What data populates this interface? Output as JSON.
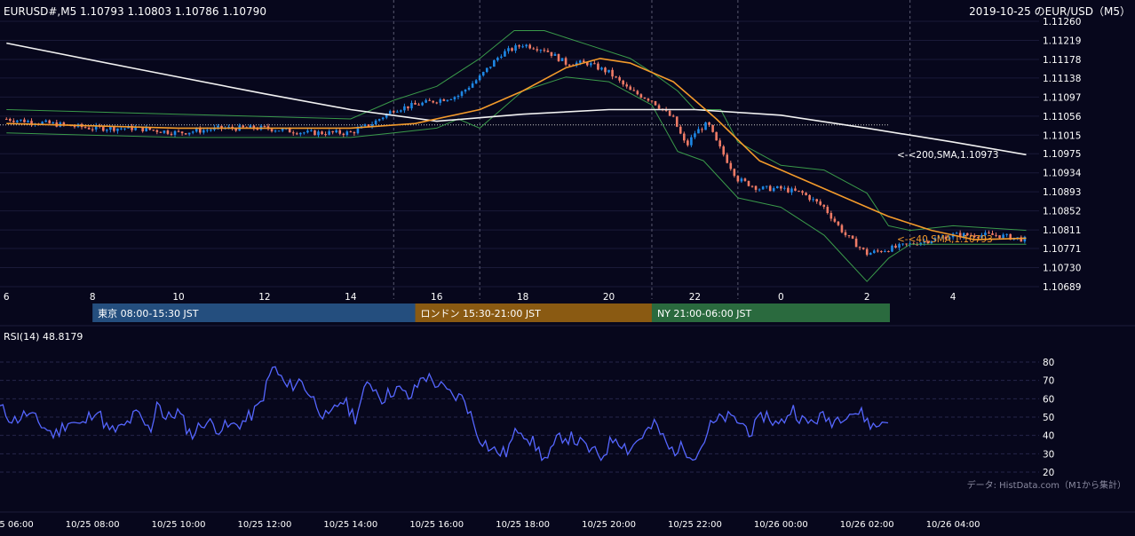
{
  "header": {
    "ohlc_label": "EURUSD#,M5 1.10793 1.10803 1.10786 1.10790",
    "right_title": "2019-10-25 のEUR/USD（M5）"
  },
  "colors": {
    "background": "#07071c",
    "candle_up": "#1e88e5",
    "candle_down": "#ef7b66",
    "sma200": "#f2f2f2",
    "sma40": "#f39a2b",
    "bollinger": "#3a9a4a",
    "rsi": "#5566ff",
    "session_tokyo": "#244e7e",
    "session_london": "#8a5a12",
    "session_ny": "#2a6a3e"
  },
  "sessions": [
    {
      "label": "東京 08:00-15:30 JST",
      "start_hour": 8,
      "end_hour": 15.5
    },
    {
      "label": "ロンドン 15:30-21:00 JST",
      "start_hour": 15.5,
      "end_hour": 21
    },
    {
      "label": "NY 21:00-06:00 JST",
      "start_hour": 21,
      "end_hour": 30
    }
  ],
  "indicator_labels": {
    "sma200": "<-<200,SMA,1.10973",
    "sma40": "<-<40,SMA,1.10793"
  },
  "rsi_label": "RSI(14) 48.8179",
  "source_note": "データ: HistData.com（M1から集計）",
  "chart_data": [
    {
      "type": "candlestick",
      "timeframe": "M5",
      "x_unit": "hours since 2019-10-25 00:00 JST",
      "x_range": [
        6,
        29.7
      ],
      "ylim": [
        1.10689,
        1.1126
      ],
      "y_ticks": [
        "1.11260",
        "1.11219",
        "1.11178",
        "1.11138",
        "1.11097",
        "1.11056",
        "1.11015",
        "1.10975",
        "1.10934",
        "1.10893",
        "1.10852",
        "1.10811",
        "1.10771",
        "1.10730",
        "1.10689"
      ],
      "x_ticks": [
        {
          "x": 6,
          "label": "6"
        },
        {
          "x": 8,
          "label": "8"
        },
        {
          "x": 10,
          "label": "10"
        },
        {
          "x": 12,
          "label": "12"
        },
        {
          "x": 14,
          "label": "14"
        },
        {
          "x": 16,
          "label": "16"
        },
        {
          "x": 18,
          "label": "18"
        },
        {
          "x": 20,
          "label": "20"
        },
        {
          "x": 22,
          "label": "22"
        },
        {
          "x": 24,
          "label": "0"
        },
        {
          "x": 26,
          "label": "2"
        },
        {
          "x": 28,
          "label": "4"
        }
      ],
      "vlines_x": [
        15,
        17,
        21,
        23,
        27
      ],
      "hline_y": 1.11037,
      "close_path": [
        [
          6,
          1.1105
        ],
        [
          7,
          1.1104
        ],
        [
          8,
          1.1103
        ],
        [
          9,
          1.1103
        ],
        [
          10,
          1.1102
        ],
        [
          11,
          1.1103
        ],
        [
          12,
          1.1103
        ],
        [
          13,
          1.1102
        ],
        [
          14,
          1.1102
        ],
        [
          14.5,
          1.1104
        ],
        [
          15,
          1.1107
        ],
        [
          15.5,
          1.1108
        ],
        [
          16,
          1.1109
        ],
        [
          16.5,
          1.111
        ],
        [
          17,
          1.1114
        ],
        [
          17.5,
          1.1119
        ],
        [
          18,
          1.1121
        ],
        [
          18.5,
          1.112
        ],
        [
          19,
          1.1117
        ],
        [
          19.5,
          1.1117
        ],
        [
          20,
          1.1115
        ],
        [
          20.5,
          1.1111
        ],
        [
          21,
          1.1109
        ],
        [
          21.5,
          1.1105
        ],
        [
          21.8,
          1.1099
        ],
        [
          22,
          1.1102
        ],
        [
          22.3,
          1.1104
        ],
        [
          22.5,
          1.11
        ],
        [
          23,
          1.1092
        ],
        [
          23.5,
          1.109
        ],
        [
          24,
          1.109
        ],
        [
          24.5,
          1.1089
        ],
        [
          25,
          1.1086
        ],
        [
          25.5,
          1.108
        ],
        [
          26,
          1.1076
        ],
        [
          26.5,
          1.1077
        ],
        [
          27,
          1.1078
        ],
        [
          27.5,
          1.1079
        ],
        [
          28,
          1.108
        ],
        [
          28.5,
          1.108
        ],
        [
          29,
          1.108
        ],
        [
          29.7,
          1.1079
        ]
      ],
      "sma200_path": [
        [
          6,
          1.11213
        ],
        [
          9,
          1.11158
        ],
        [
          12,
          1.11104
        ],
        [
          14,
          1.1107
        ],
        [
          16,
          1.11045
        ],
        [
          18,
          1.1106
        ],
        [
          20,
          1.1107
        ],
        [
          22,
          1.1107
        ],
        [
          24,
          1.11058
        ],
        [
          26,
          1.1103
        ],
        [
          28,
          1.11
        ],
        [
          29.7,
          1.10973
        ]
      ],
      "sma40_path": [
        [
          6,
          1.1104
        ],
        [
          10,
          1.1103
        ],
        [
          14,
          1.1103
        ],
        [
          15.5,
          1.1104
        ],
        [
          17,
          1.1107
        ],
        [
          18,
          1.1111
        ],
        [
          19,
          1.1116
        ],
        [
          19.8,
          1.1118
        ],
        [
          20.5,
          1.1117
        ],
        [
          21.5,
          1.1113
        ],
        [
          22.5,
          1.1105
        ],
        [
          23.5,
          1.1096
        ],
        [
          24.5,
          1.1092
        ],
        [
          25.5,
          1.1088
        ],
        [
          26.5,
          1.1084
        ],
        [
          27.5,
          1.1081
        ],
        [
          28.5,
          1.1079
        ],
        [
          29.7,
          1.10793
        ]
      ],
      "boll_upper_path": [
        [
          6,
          1.1107
        ],
        [
          10,
          1.1106
        ],
        [
          14,
          1.1105
        ],
        [
          15,
          1.1109
        ],
        [
          16,
          1.1112
        ],
        [
          17,
          1.1118
        ],
        [
          17.8,
          1.1124
        ],
        [
          18.5,
          1.1124
        ],
        [
          19.5,
          1.1121
        ],
        [
          20.5,
          1.1118
        ],
        [
          21,
          1.1115
        ],
        [
          21.6,
          1.1111
        ],
        [
          22,
          1.1107
        ],
        [
          22.6,
          1.1107
        ],
        [
          23,
          1.11
        ],
        [
          24,
          1.1095
        ],
        [
          25,
          1.1094
        ],
        [
          26,
          1.1089
        ],
        [
          26.5,
          1.1082
        ],
        [
          27,
          1.1081
        ],
        [
          28,
          1.1082
        ],
        [
          29.7,
          1.1081
        ]
      ],
      "boll_lower_path": [
        [
          6,
          1.1102
        ],
        [
          10,
          1.1101
        ],
        [
          14,
          1.1101
        ],
        [
          15,
          1.1102
        ],
        [
          16,
          1.1103
        ],
        [
          16.5,
          1.1105
        ],
        [
          17,
          1.1103
        ],
        [
          18,
          1.1111
        ],
        [
          19,
          1.1114
        ],
        [
          20,
          1.1113
        ],
        [
          21,
          1.1108
        ],
        [
          21.6,
          1.1098
        ],
        [
          22.2,
          1.1096
        ],
        [
          23,
          1.1088
        ],
        [
          24,
          1.1086
        ],
        [
          25,
          1.108
        ],
        [
          25.5,
          1.1075
        ],
        [
          26,
          1.107
        ],
        [
          26.5,
          1.1075
        ],
        [
          27,
          1.1078
        ],
        [
          28,
          1.1078
        ],
        [
          29.7,
          1.1078
        ]
      ]
    },
    {
      "type": "line",
      "name": "RSI(14)",
      "ylim": [
        20,
        80
      ],
      "y_ticks": [
        20,
        30,
        40,
        50,
        60,
        70,
        80
      ],
      "x_range": [
        6,
        29.7
      ],
      "path": [
        [
          6,
          55
        ],
        [
          6.5,
          48
        ],
        [
          7,
          52
        ],
        [
          7.5,
          46
        ],
        [
          8,
          40
        ],
        [
          8.5,
          48
        ],
        [
          9,
          45
        ],
        [
          9.5,
          55
        ],
        [
          10,
          42
        ],
        [
          10.5,
          44
        ],
        [
          11,
          52
        ],
        [
          11.5,
          42
        ],
        [
          11.8,
          62
        ],
        [
          12,
          48
        ],
        [
          12.5,
          53
        ],
        [
          13,
          40
        ],
        [
          13.5,
          48
        ],
        [
          14,
          44
        ],
        [
          14.5,
          45
        ],
        [
          15,
          48
        ],
        [
          15.5,
          56
        ],
        [
          16,
          78
        ],
        [
          16.5,
          66
        ],
        [
          17,
          70
        ],
        [
          17.5,
          59
        ],
        [
          18,
          48
        ],
        [
          18.5,
          60
        ],
        [
          19,
          50
        ],
        [
          19.5,
          70
        ],
        [
          20,
          60
        ],
        [
          20.5,
          66
        ],
        [
          21,
          60
        ],
        [
          21.5,
          73
        ],
        [
          22,
          68
        ],
        [
          22.5,
          62
        ],
        [
          23,
          60
        ],
        [
          23.5,
          40
        ],
        [
          24,
          32
        ],
        [
          24.5,
          30
        ],
        [
          25,
          45
        ],
        [
          25.5,
          36
        ],
        [
          26,
          26
        ],
        [
          26.5,
          40
        ],
        [
          27,
          38
        ],
        [
          27.5,
          33
        ],
        [
          28,
          28
        ],
        [
          28.5,
          40
        ],
        [
          29,
          32
        ],
        [
          29.5,
          40
        ],
        [
          30,
          46
        ],
        [
          30.5,
          32
        ],
        [
          31,
          33
        ],
        [
          31.5,
          29
        ],
        [
          32,
          45
        ],
        [
          32.5,
          50
        ],
        [
          33,
          48
        ],
        [
          33.5,
          42
        ],
        [
          34,
          52
        ],
        [
          34.5,
          45
        ],
        [
          35,
          55
        ],
        [
          35.5,
          46
        ],
        [
          36,
          50
        ],
        [
          36.5,
          48
        ],
        [
          37,
          53
        ],
        [
          37.5,
          52
        ],
        [
          38,
          44
        ],
        [
          38.5,
          50
        ]
      ],
      "path_x_unit": "relative index (hours scale)"
    }
  ],
  "bottom_axis_labels": [
    "10/25 06:00",
    "10/25 08:00",
    "10/25 10:00",
    "10/25 12:00",
    "10/25 14:00",
    "10/25 16:00",
    "10/25 18:00",
    "10/25 20:00",
    "10/25 22:00",
    "10/26 00:00",
    "10/26 02:00",
    "10/26 04:00"
  ]
}
